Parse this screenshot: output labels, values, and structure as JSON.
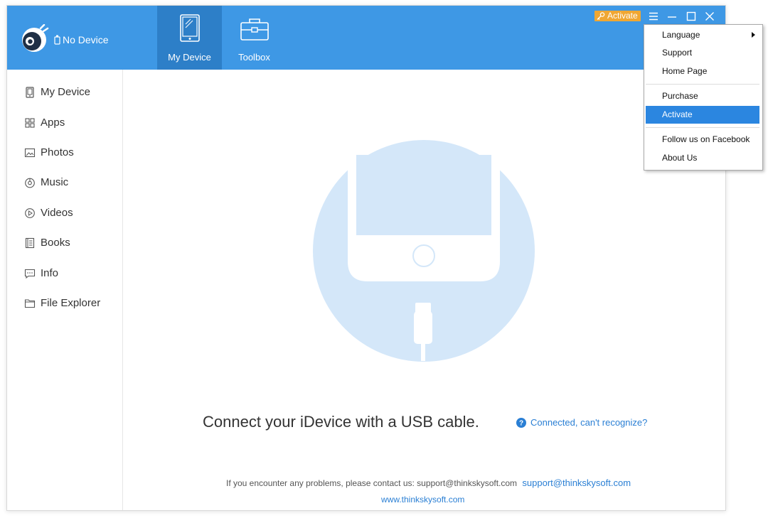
{
  "header": {
    "device_status": "No Device",
    "tabs": [
      {
        "label": "My Device",
        "icon": "tablet-icon",
        "active": true
      },
      {
        "label": "Toolbox",
        "icon": "toolbox-icon",
        "active": false
      }
    ],
    "activate_label": "Activate",
    "colors": {
      "topbar": "#3e98e5",
      "active_tab": "#2d7fc8",
      "activate_badge": "#f0a733"
    }
  },
  "sidebar": {
    "items": [
      {
        "label": "My Device",
        "icon": "device-icon"
      },
      {
        "label": "Apps",
        "icon": "apps-grid-icon"
      },
      {
        "label": "Photos",
        "icon": "photo-icon"
      },
      {
        "label": "Music",
        "icon": "music-icon"
      },
      {
        "label": "Videos",
        "icon": "video-icon"
      },
      {
        "label": "Books",
        "icon": "book-icon"
      },
      {
        "label": "Info",
        "icon": "message-icon"
      },
      {
        "label": "File Explorer",
        "icon": "folder-icon"
      }
    ]
  },
  "main": {
    "connect_message": "Connect your iDevice with a USB cable.",
    "help_link": "Connected, can't recognize?",
    "contact_text": "If you encounter any problems, please contact us: support@thinkskysoft.com",
    "contact_email": "support@thinkskysoft.com",
    "website": "www.thinkskysoft.com"
  },
  "menu": {
    "items": [
      {
        "label": "Language",
        "has_submenu": true
      },
      {
        "label": "Support"
      },
      {
        "label": "Home Page"
      },
      {
        "label": "Purchase"
      },
      {
        "label": "Activate",
        "highlighted": true
      },
      {
        "label": "Follow us on Facebook"
      },
      {
        "label": "About Us"
      }
    ]
  }
}
